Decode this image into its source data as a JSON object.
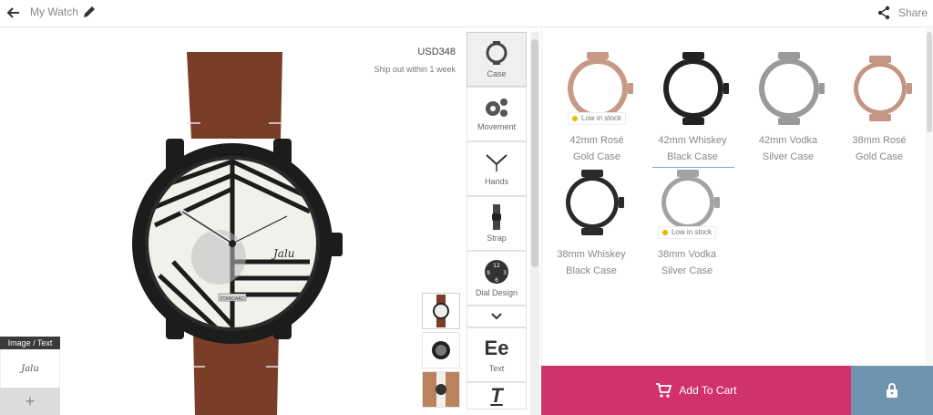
{
  "header": {
    "title": "My Watch",
    "share_label": "Share"
  },
  "preview": {
    "price": "USD348",
    "ship_note": "Ship out within 1 week",
    "dial_brand": "Jalu",
    "dial_mark": "STANDARD"
  },
  "image_text_panel": {
    "label": "Image / Text",
    "signature": "Jalu",
    "add_label": "+"
  },
  "categories": [
    {
      "label": "Case",
      "icon": "case-icon"
    },
    {
      "label": "Movement",
      "icon": "gears-icon"
    },
    {
      "label": "Hands",
      "icon": "hands-icon"
    },
    {
      "label": "Strap",
      "icon": "strap-icon"
    },
    {
      "label": "Dial Design",
      "icon": "dial-icon"
    },
    {
      "label": "Text",
      "icon": "text-icon",
      "glyph": "Ee"
    }
  ],
  "options": [
    {
      "line1": "42mm Rosé",
      "line2": "Gold Case",
      "color": "#c79a86",
      "badge": "Low in stock"
    },
    {
      "line1": "42mm Whiskey",
      "line2": "Black Case",
      "color": "#222222",
      "selected": true
    },
    {
      "line1": "42mm Vodka",
      "line2": "Silver Case",
      "color": "#9a9a9a"
    },
    {
      "line1": "38mm Rosé",
      "line2": "Gold Case",
      "color": "#c49584"
    },
    {
      "line1": "38mm Whiskey",
      "line2": "Black Case",
      "color": "#2a2a2a"
    },
    {
      "line1": "38mm Vodka",
      "line2": "Silver Case",
      "color": "#a3a3a3",
      "badge": "Low in stock"
    }
  ],
  "cart": {
    "label": "Add To Cart"
  },
  "colors": {
    "accent": "#d1326e",
    "lock": "#6e95ad",
    "strap": "#7a3e28"
  }
}
